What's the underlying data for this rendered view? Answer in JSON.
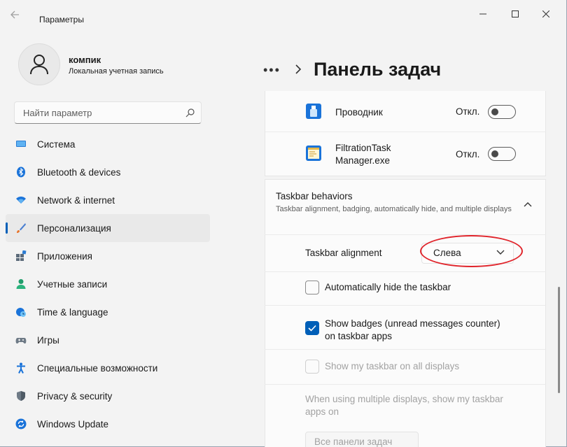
{
  "window": {
    "title": "Параметры",
    "back_icon": "arrow-left-icon",
    "controls": [
      "minimize-icon",
      "maximize-icon",
      "close-icon"
    ]
  },
  "profile": {
    "name": "компик",
    "account_type": "Локальная учетная запись"
  },
  "search": {
    "placeholder": "Найти параметр"
  },
  "sidebar": {
    "items": [
      {
        "label": "Система",
        "icon": "monitor-icon"
      },
      {
        "label": "Bluetooth & devices",
        "icon": "bluetooth-icon"
      },
      {
        "label": "Network & internet",
        "icon": "wifi-icon"
      },
      {
        "label": "Персонализация",
        "icon": "brush-icon",
        "active": true
      },
      {
        "label": "Приложения",
        "icon": "apps-icon"
      },
      {
        "label": "Учетные записи",
        "icon": "person-icon"
      },
      {
        "label": "Time & language",
        "icon": "globe-clock-icon"
      },
      {
        "label": "Игры",
        "icon": "gamepad-icon"
      },
      {
        "label": "Специальные возможности",
        "icon": "accessibility-icon"
      },
      {
        "label": "Privacy & security",
        "icon": "shield-icon"
      },
      {
        "label": "Windows Update",
        "icon": "update-icon"
      }
    ]
  },
  "header": {
    "dots": "•••",
    "title": "Панель задач"
  },
  "tray_apps": [
    {
      "name": "Проводник",
      "state": "Откл.",
      "icon": "usb-drive-icon"
    },
    {
      "name_line1": "FiltrationTask",
      "name_line2": "Manager.exe",
      "state": "Откл.",
      "icon": "task-manager-icon"
    }
  ],
  "behaviors": {
    "title": "Taskbar behaviors",
    "description": "Taskbar alignment, badging, automatically hide, and multiple displays",
    "alignment_label": "Taskbar alignment",
    "alignment_value": "Слева",
    "auto_hide_label": "Automatically hide the taskbar",
    "auto_hide_checked": false,
    "badges_label_line1": "Show badges (unread messages counter)",
    "badges_label_line2": "on taskbar apps",
    "badges_checked": true,
    "all_displays_label": "Show my taskbar on all displays",
    "all_displays_checked": false,
    "multi_label_line1": "When using multiple displays, show my taskbar",
    "multi_label_line2": "apps on",
    "multi_value": "Все панели задач"
  },
  "colors": {
    "accent": "#005fb8",
    "annotation": "#e0242b"
  }
}
